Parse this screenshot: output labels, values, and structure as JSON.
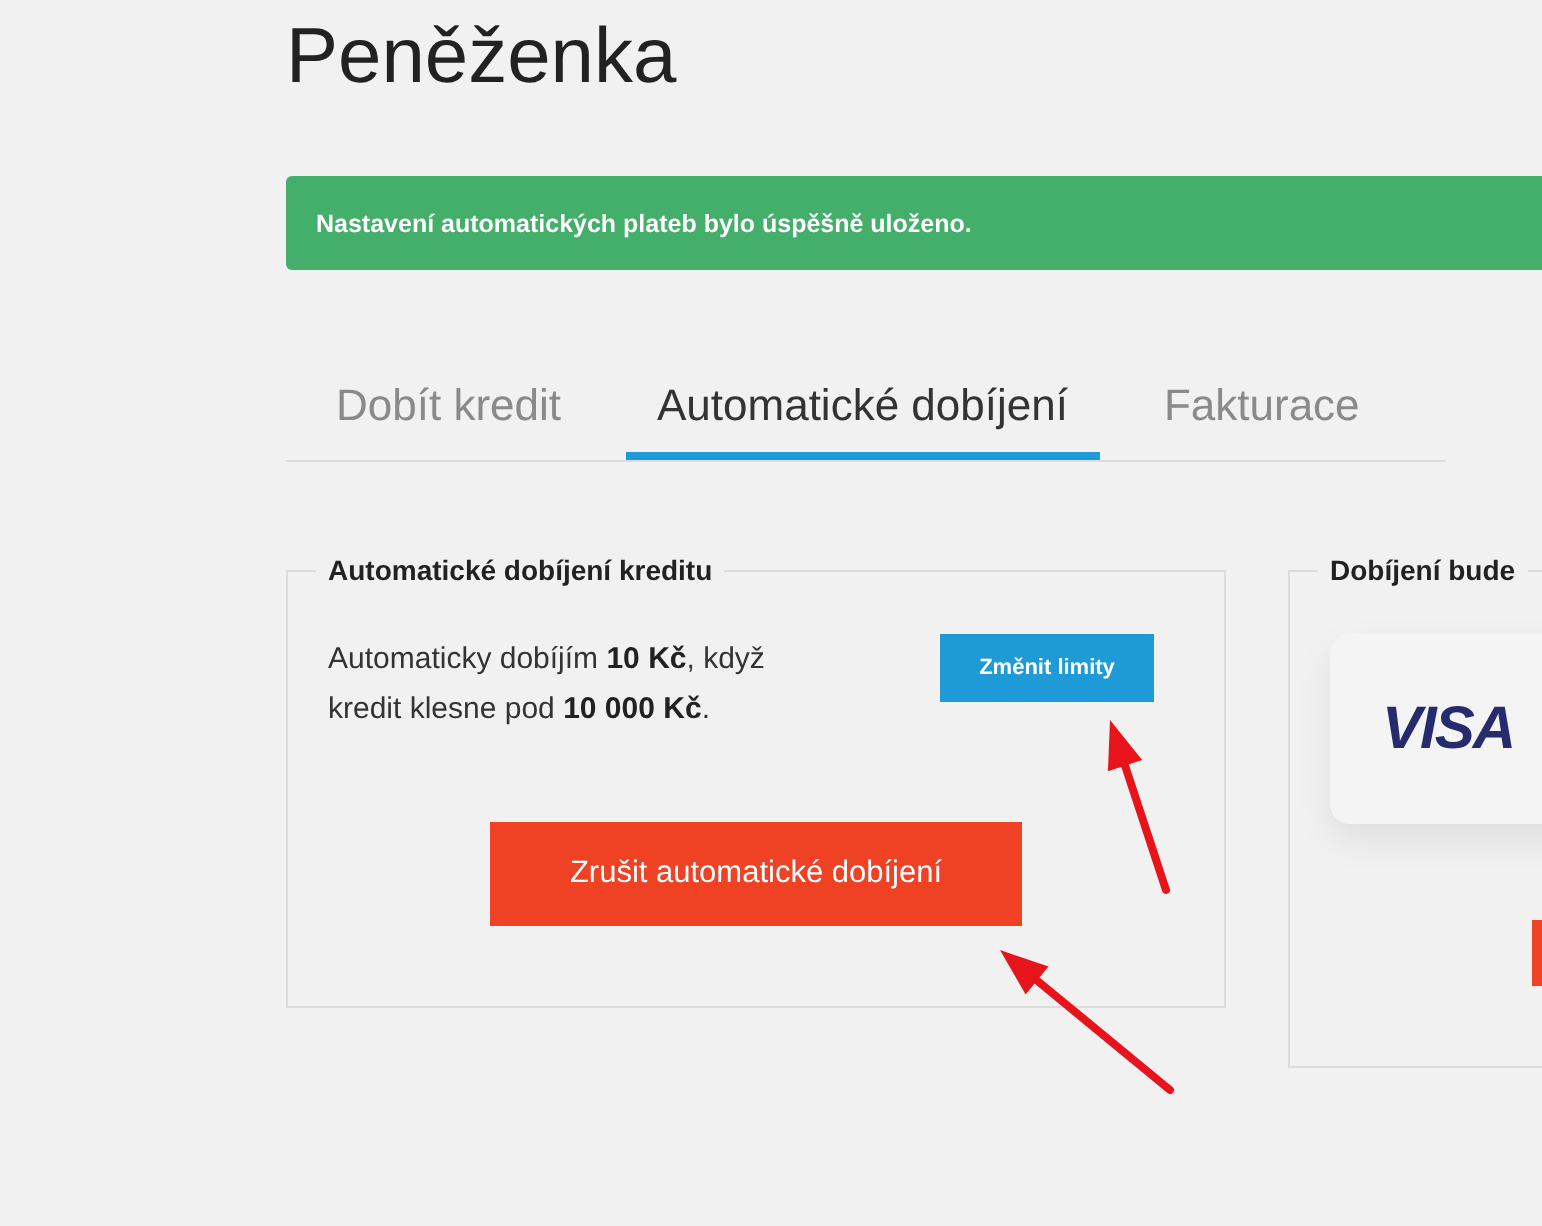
{
  "page": {
    "title": "Peněženka"
  },
  "alert": {
    "kind": "success",
    "message": "Nastavení automatických plateb bylo úspěšně uloženo."
  },
  "tabs": [
    {
      "label": "Dobít kredit",
      "selected": false
    },
    {
      "label": "Automatické dobíjení",
      "selected": true
    },
    {
      "label": "Fakturace",
      "selected": false
    }
  ],
  "auto_topup": {
    "legend": "Automatické dobíjení kreditu",
    "description": "Automaticky dobíjím **10 Kč**, když kredit klesne pod **10 000 Kč**.",
    "change_button": "Změnit limity",
    "cancel_button": "Zrušit automatické dobíjení"
  },
  "payment": {
    "legend": "Dobíjení bude",
    "card_brand": "VISA"
  }
}
